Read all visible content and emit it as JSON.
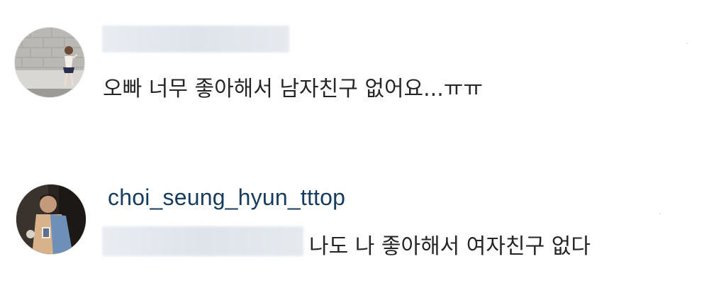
{
  "comments": [
    {
      "avatar_icon": "user-avatar-photo-icon",
      "username": "",
      "username_redacted": true,
      "text": "오빠 너무 좋아해서 남자친구 없어요...ㅠㅠ"
    },
    {
      "avatar_icon": "user-avatar-photo-icon",
      "username": "choi_seung_hyun_tttop",
      "mention_redacted": true,
      "text": "나도 나 좋아해서 여자친구 없다"
    }
  ],
  "colors": {
    "username": "#173c5e",
    "text": "#262626",
    "redaction": "#e3e8ee",
    "background": "#ffffff"
  }
}
